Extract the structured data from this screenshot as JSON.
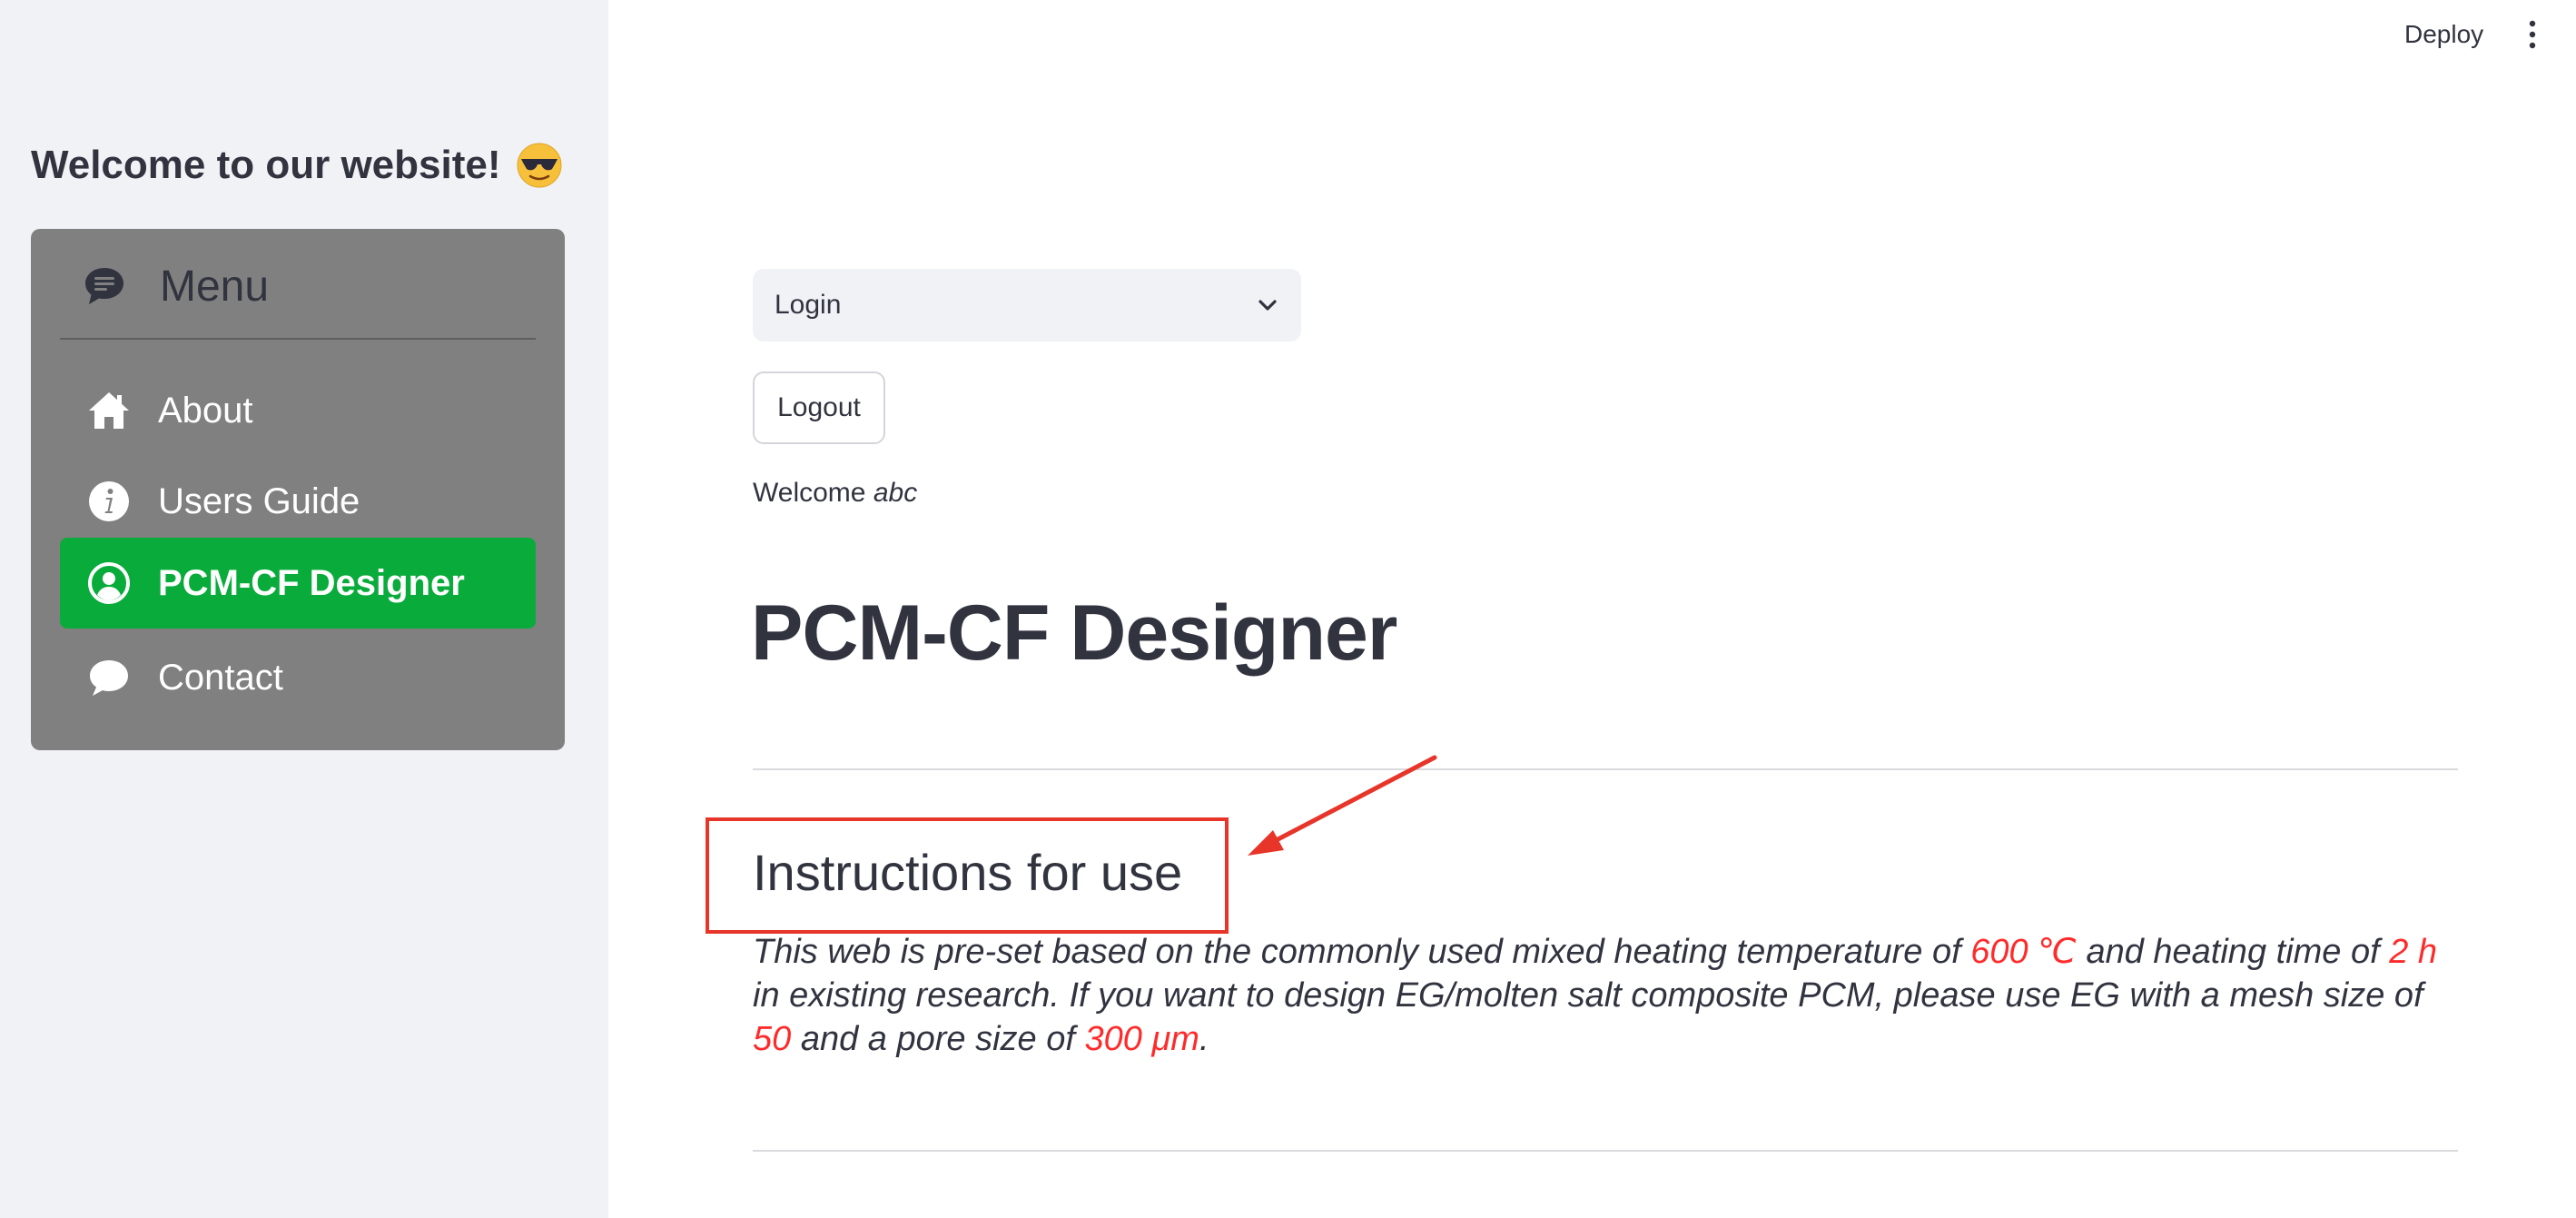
{
  "header": {
    "deploy_label": "Deploy",
    "more_icon": "kebab-menu-icon"
  },
  "sidebar": {
    "title": "Welcome to our website!",
    "title_emoji": "smiling-face-with-sunglasses",
    "menu": {
      "title": "Menu",
      "title_icon": "chat-square-text-icon",
      "items": [
        {
          "label": "About",
          "icon": "house-icon",
          "active": false
        },
        {
          "label": "Users Guide",
          "icon": "info-circle-icon",
          "active": false
        },
        {
          "label": "PCM-CF Designer",
          "icon": "person-circle-icon",
          "active": true
        },
        {
          "label": "Contact",
          "icon": "chat-bubble-icon",
          "active": false
        }
      ]
    }
  },
  "main": {
    "login_select": {
      "value": "Login"
    },
    "logout_label": "Logout",
    "welcome_prefix": "Welcome",
    "welcome_user": "abc",
    "page_title": "PCM-CF Designer",
    "section_heading": "Instructions for use",
    "instructions": {
      "part1": "This web is pre-set based on the commonly used mixed heating temperature of ",
      "temp": "600 ℃",
      "part2": " and heating time of ",
      "time": "2 h",
      "part3": " in existing research. If you want to design EG/molten salt composite PCM, please use EG with a mesh size of ",
      "mesh": "50",
      "part4": " and a pore size of ",
      "pore": "300 μm",
      "part5": "."
    }
  },
  "colors": {
    "sidebar_bg": "#f0f2f6",
    "menu_bg": "#808080",
    "active_item": "#09ab3b",
    "highlight_text": "#ff2b2b",
    "annotation": "#e8352a",
    "text": "#31333f"
  }
}
